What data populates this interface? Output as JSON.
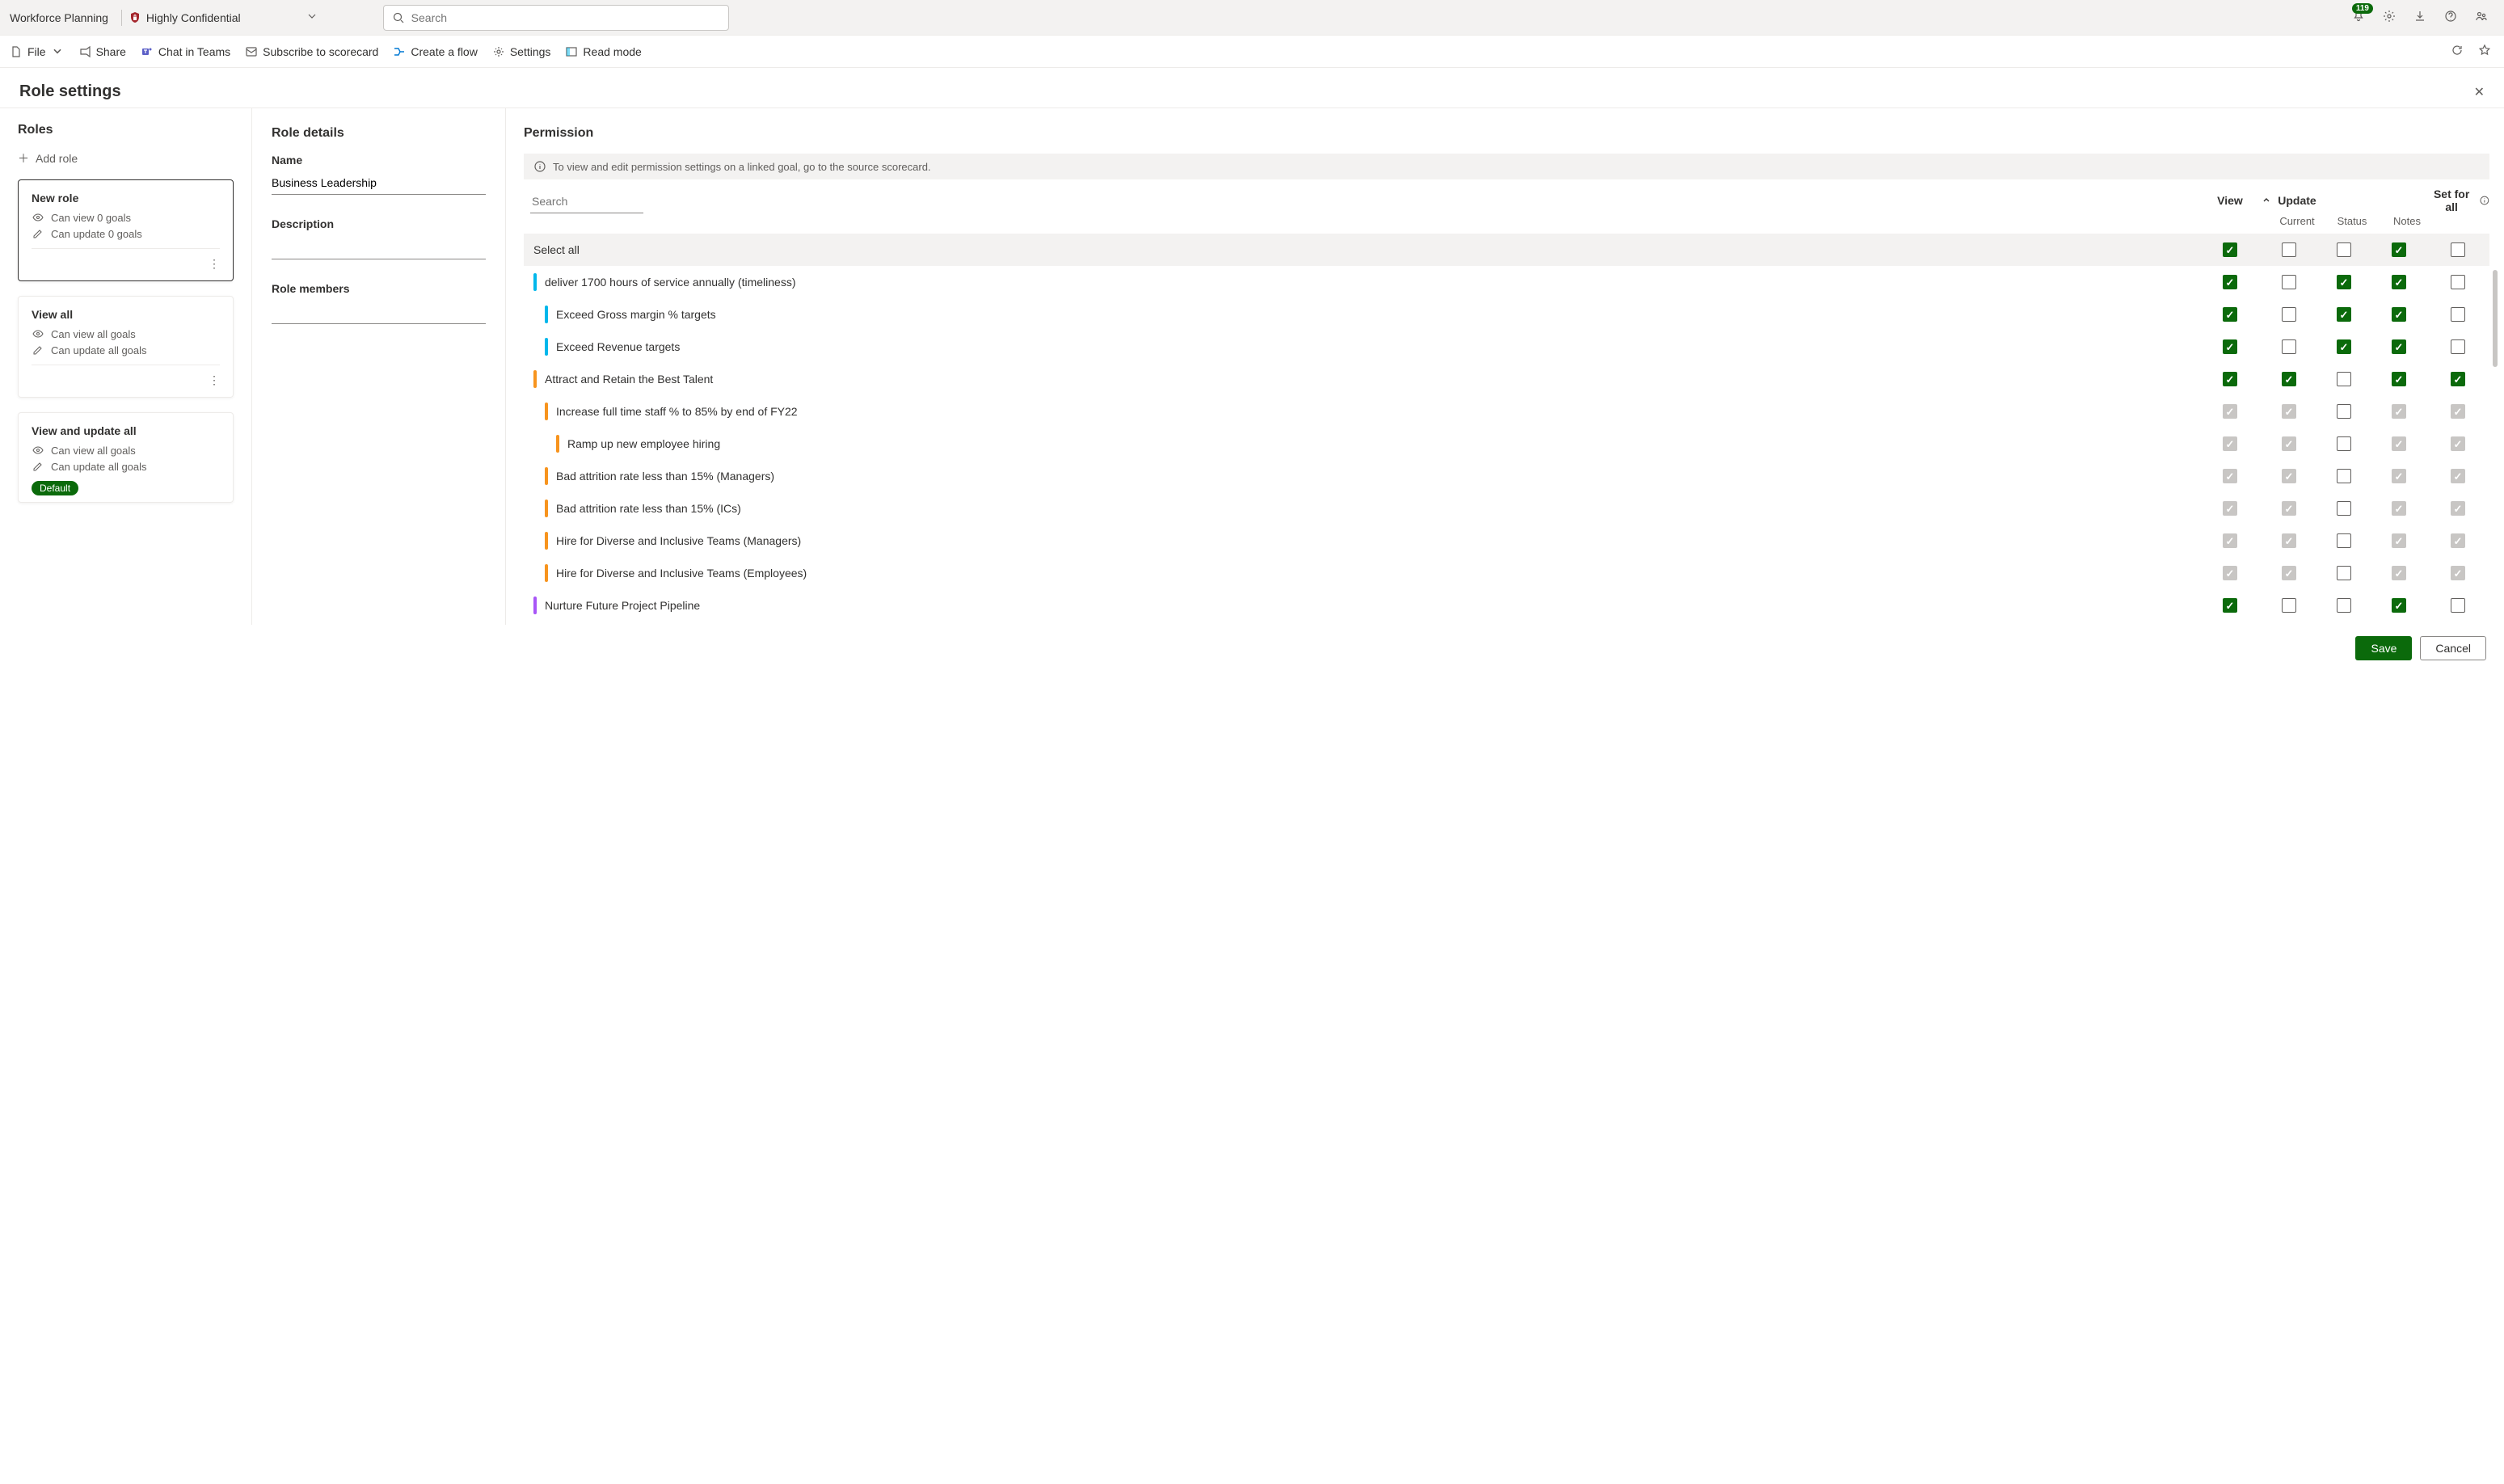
{
  "header": {
    "app_name": "Workforce Planning",
    "sensitivity_label": "Highly Confidential",
    "search_placeholder": "Search",
    "notification_count": "119"
  },
  "command_bar": {
    "file": "File",
    "share": "Share",
    "chat": "Chat in Teams",
    "subscribe": "Subscribe to scorecard",
    "flow": "Create a flow",
    "settings": "Settings",
    "read_mode": "Read mode"
  },
  "page_title": "Role settings",
  "roles_panel": {
    "title": "Roles",
    "add_role": "Add role",
    "roles": [
      {
        "title": "New role",
        "view_line": "Can view 0 goals",
        "update_line": "Can update 0 goals",
        "selected": true,
        "show_more": true,
        "default": false
      },
      {
        "title": "View all",
        "view_line": "Can view all goals",
        "update_line": "Can update all goals",
        "selected": false,
        "show_more": true,
        "default": false
      },
      {
        "title": "View and update all",
        "view_line": "Can view all goals",
        "update_line": "Can update all goals",
        "selected": false,
        "show_more": false,
        "default": true,
        "default_label": "Default"
      }
    ]
  },
  "details_panel": {
    "title": "Role details",
    "name_label": "Name",
    "name_value": "Business Leadership",
    "description_label": "Description",
    "description_value": "",
    "members_label": "Role members",
    "members_value": ""
  },
  "permission_panel": {
    "title": "Permission",
    "banner": "To view and edit permission settings on a linked goal, go to the source scorecard.",
    "search_placeholder": "Search",
    "col_view": "View",
    "col_update": "Update",
    "col_current": "Current",
    "col_status": "Status",
    "col_notes": "Notes",
    "col_setfor": "Set for all",
    "select_all": "Select all",
    "select_all_state": {
      "view": "checked",
      "current": "empty",
      "status": "empty",
      "notes": "checked",
      "setfor": "empty"
    },
    "goals": [
      {
        "label": "deliver 1700 hours of service annually (timeliness)",
        "indent": 0,
        "color": "#00b7eb",
        "cells": {
          "view": "checked",
          "current": "empty",
          "status": "checked",
          "notes": "checked",
          "setfor": "empty"
        }
      },
      {
        "label": "Exceed Gross margin % targets",
        "indent": 1,
        "color": "#00b7eb",
        "cells": {
          "view": "checked",
          "current": "empty",
          "status": "checked",
          "notes": "checked",
          "setfor": "empty"
        }
      },
      {
        "label": "Exceed Revenue targets",
        "indent": 1,
        "color": "#00b7eb",
        "cells": {
          "view": "checked",
          "current": "empty",
          "status": "checked",
          "notes": "checked",
          "setfor": "empty"
        }
      },
      {
        "label": "Attract and Retain the Best Talent",
        "indent": 0,
        "color": "#f7941e",
        "cells": {
          "view": "checked",
          "current": "checked",
          "status": "empty",
          "notes": "checked",
          "setfor": "checked"
        }
      },
      {
        "label": "Increase full time staff % to 85% by end of FY22",
        "indent": 1,
        "color": "#f7941e",
        "cells": {
          "view": "disabled",
          "current": "disabled",
          "status": "empty",
          "notes": "disabled",
          "setfor": "disabled"
        }
      },
      {
        "label": "Ramp up new employee hiring",
        "indent": 2,
        "color": "#f7941e",
        "cells": {
          "view": "disabled",
          "current": "disabled",
          "status": "empty",
          "notes": "disabled",
          "setfor": "disabled"
        }
      },
      {
        "label": "Bad attrition rate less than 15% (Managers)",
        "indent": 1,
        "color": "#f7941e",
        "cells": {
          "view": "disabled",
          "current": "disabled",
          "status": "empty",
          "notes": "disabled",
          "setfor": "disabled"
        }
      },
      {
        "label": "Bad attrition rate less than 15% (ICs)",
        "indent": 1,
        "color": "#f7941e",
        "cells": {
          "view": "disabled",
          "current": "disabled",
          "status": "empty",
          "notes": "disabled",
          "setfor": "disabled"
        }
      },
      {
        "label": "Hire for Diverse and Inclusive Teams (Managers)",
        "indent": 1,
        "color": "#f7941e",
        "cells": {
          "view": "disabled",
          "current": "disabled",
          "status": "empty",
          "notes": "disabled",
          "setfor": "disabled"
        }
      },
      {
        "label": "Hire for Diverse and Inclusive Teams (Employees)",
        "indent": 1,
        "color": "#f7941e",
        "cells": {
          "view": "disabled",
          "current": "disabled",
          "status": "empty",
          "notes": "disabled",
          "setfor": "disabled"
        }
      },
      {
        "label": "Nurture Future Project Pipeline",
        "indent": 0,
        "color": "#a855f7",
        "cells": {
          "view": "checked",
          "current": "empty",
          "status": "empty",
          "notes": "checked",
          "setfor": "empty"
        }
      }
    ]
  },
  "footer": {
    "save": "Save",
    "cancel": "Cancel"
  }
}
